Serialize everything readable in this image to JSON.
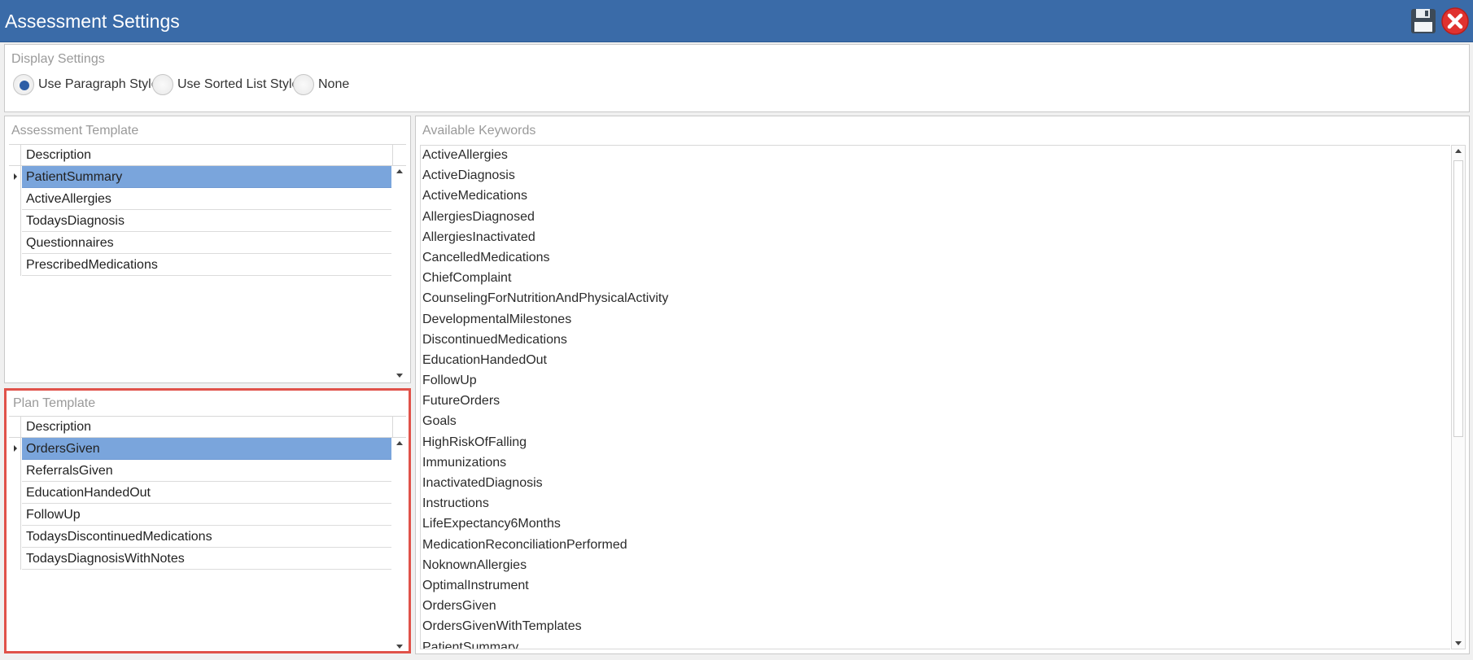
{
  "window": {
    "title": "Assessment Settings"
  },
  "display_settings": {
    "label": "Display Settings",
    "options": [
      {
        "label": "Use Paragraph Style",
        "checked": true
      },
      {
        "label": "Use Sorted List Style",
        "checked": false
      },
      {
        "label": "None",
        "checked": false
      }
    ]
  },
  "assessment_template": {
    "label": "Assessment Template",
    "column_header": "Description",
    "rows": [
      "PatientSummary",
      "ActiveAllergies",
      "TodaysDiagnosis",
      "Questionnaires",
      "PrescribedMedications"
    ],
    "selected_index": 0
  },
  "plan_template": {
    "label": "Plan Template",
    "column_header": "Description",
    "rows": [
      "OrdersGiven",
      "ReferralsGiven",
      "EducationHandedOut",
      "FollowUp",
      "TodaysDiscontinuedMedications",
      "TodaysDiagnosisWithNotes"
    ],
    "selected_index": 0
  },
  "available_keywords": {
    "label": "Available Keywords",
    "items": [
      "ActiveAllergies",
      "ActiveDiagnosis",
      "ActiveMedications",
      "AllergiesDiagnosed",
      "AllergiesInactivated",
      "CancelledMedications",
      "ChiefComplaint",
      "CounselingForNutritionAndPhysicalActivity",
      "DevelopmentalMilestones",
      "DiscontinuedMedications",
      "EducationHandedOut",
      "FollowUp",
      "FutureOrders",
      "Goals",
      "HighRiskOfFalling",
      "Immunizations",
      "InactivatedDiagnosis",
      "Instructions",
      "LifeExpectancy6Months",
      "MedicationReconciliationPerformed",
      "NoknownAllergies",
      "OptimalInstrument",
      "OrdersGiven",
      "OrdersGivenWithTemplates",
      "PatientSummary"
    ]
  },
  "icons": {
    "save": "save-disk-icon",
    "close": "close-icon"
  },
  "colors": {
    "titlebar": "#3a6ba8",
    "selection": "#7aa5dc",
    "highlight_border": "#e0524a",
    "close_red": "#e0322f"
  }
}
